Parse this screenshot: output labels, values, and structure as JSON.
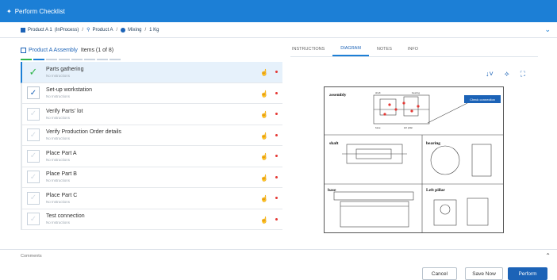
{
  "window": {
    "title": "Perform Checklist"
  },
  "breadcrumb": {
    "product": "Product A 1",
    "status": "(InProcess)",
    "part": "Product A",
    "step": "Mixing",
    "quantity": "1 Kg",
    "separator": "/"
  },
  "checklist": {
    "title": "Product A Assembly",
    "count": "Items (1 of 8)",
    "items": [
      {
        "title": "Parts gathering",
        "sub": "No Instructions"
      },
      {
        "title": "Set-up workstation",
        "sub": "No Instructions"
      },
      {
        "title": "Verify Parts' lot",
        "sub": "No Instructions"
      },
      {
        "title": "Verify Production Order details",
        "sub": "No Instructions"
      },
      {
        "title": "Place Part A",
        "sub": "No Instructions"
      },
      {
        "title": "Place Part B",
        "sub": "No Instructions"
      },
      {
        "title": "Place Part C",
        "sub": "No Instructions"
      },
      {
        "title": "Test connection",
        "sub": "No Instructions"
      }
    ]
  },
  "tabs": [
    "INSTRUCTIONS",
    "DIAGRAM",
    "NOTES",
    "INFO"
  ],
  "active_tab": "DIAGRAM",
  "diagram": {
    "assembly_label": "assembly",
    "shaft_label": "shaft",
    "bearing_label": "bearing",
    "base_label": "base",
    "left_pillar_label": "Left pillar",
    "callout": "Check connection",
    "part_tags": {
      "shaft": "shaft",
      "bearing": "bearing",
      "base": "base",
      "left_pillar": "left pillar"
    }
  },
  "comments": {
    "label": "Comments"
  },
  "buttons": {
    "cancel": "Cancel",
    "save_now": "Save Now",
    "perform": "Perform"
  },
  "colors": {
    "primary": "#1c7fd6",
    "dark_primary": "#1c63b7",
    "done": "#2fb54a",
    "danger": "#e53935"
  }
}
